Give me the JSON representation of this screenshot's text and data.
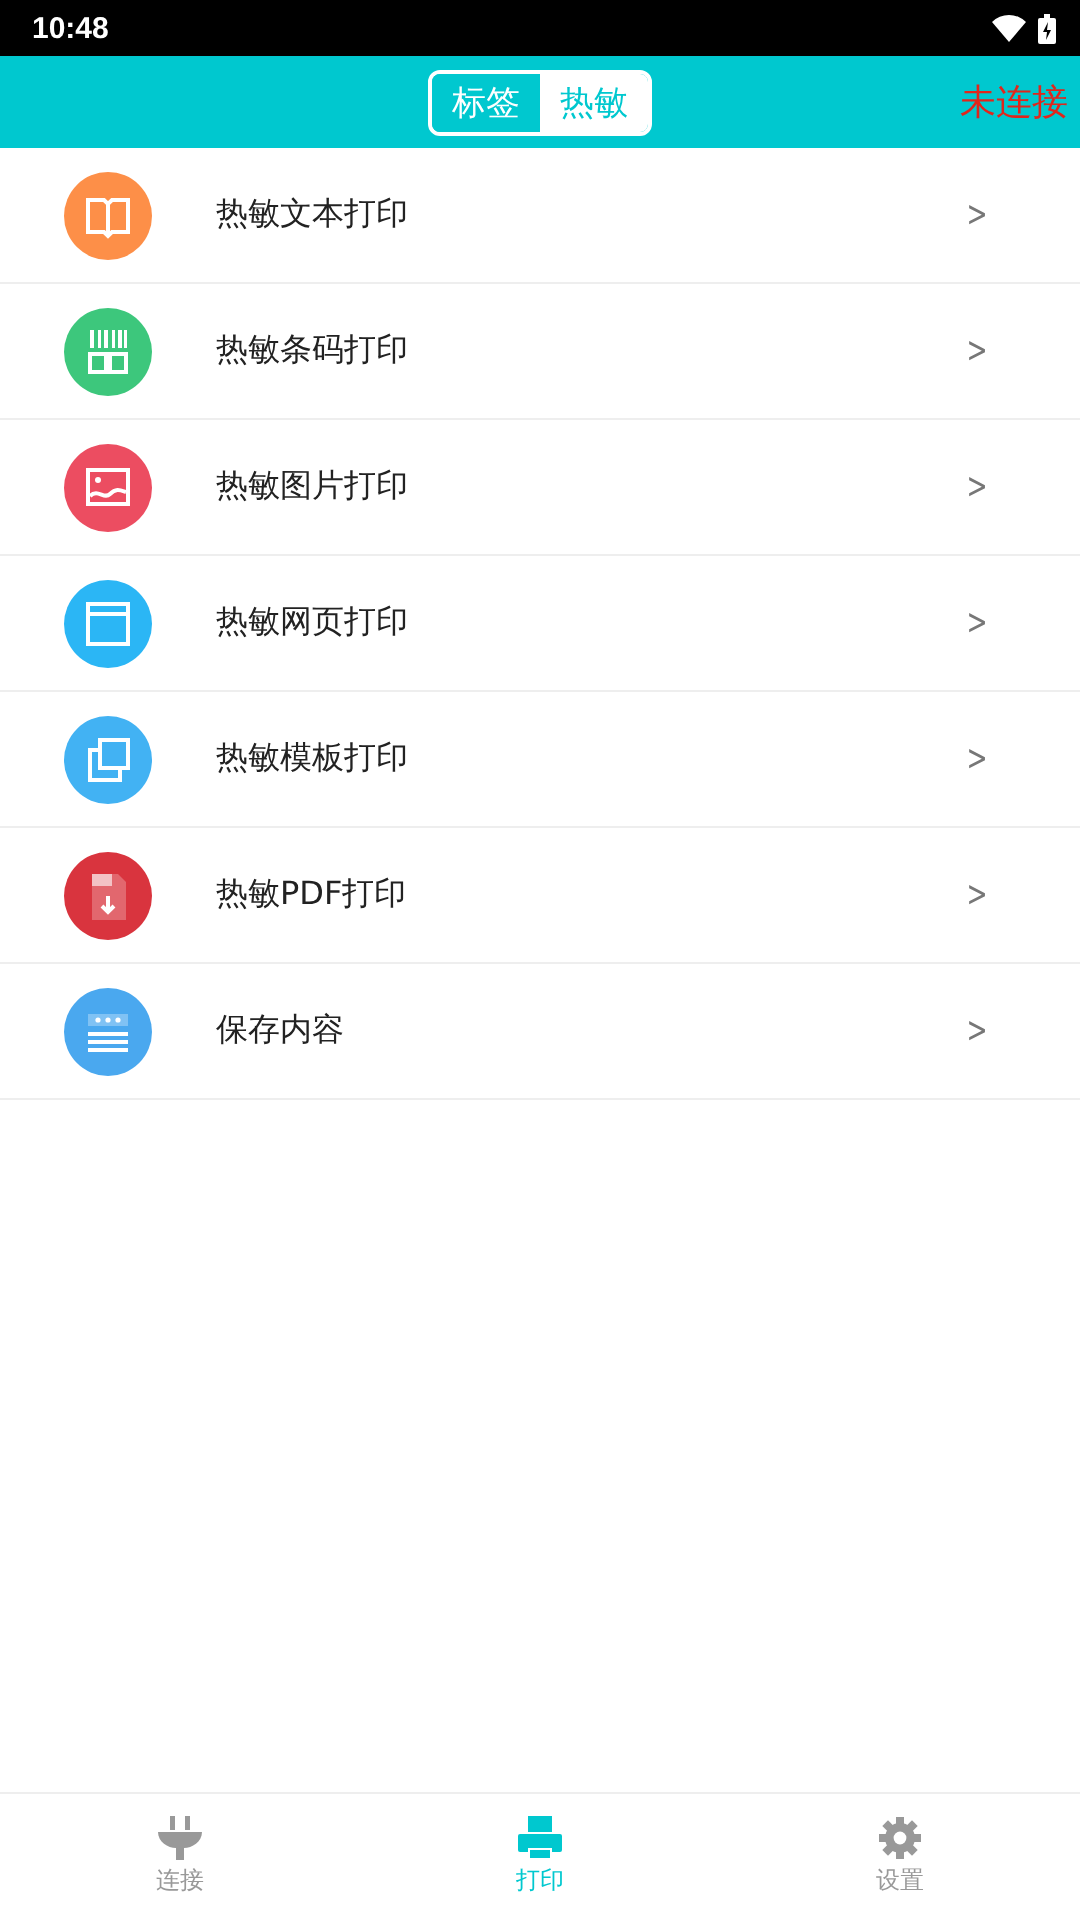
{
  "status_bar": {
    "time": "10:48"
  },
  "header": {
    "tabs": [
      {
        "label": "标签",
        "selected": false
      },
      {
        "label": "热敏",
        "selected": true
      }
    ],
    "connection": "未连接"
  },
  "menu": [
    {
      "label": "热敏文本打印",
      "kind": "book",
      "color": "#fd8f48"
    },
    {
      "label": "热敏条码打印",
      "kind": "barcode",
      "color": "#3dc77c"
    },
    {
      "label": "热敏图片打印",
      "kind": "image",
      "color": "#ec4d61"
    },
    {
      "label": "热敏网页打印",
      "kind": "web",
      "color": "#2bb6f5"
    },
    {
      "label": "热敏模板打印",
      "kind": "copy",
      "color": "#42b2f3"
    },
    {
      "label": "热敏PDF打印",
      "kind": "pdf",
      "color": "#d9343e"
    },
    {
      "label": "保存内容",
      "kind": "list",
      "color": "#4aa8ef"
    }
  ],
  "chevron": ">",
  "bottom_nav": [
    {
      "label": "连接",
      "kind": "plug",
      "selected": false
    },
    {
      "label": "打印",
      "kind": "printer",
      "selected": true
    },
    {
      "label": "设置",
      "kind": "gear",
      "selected": false
    }
  ]
}
